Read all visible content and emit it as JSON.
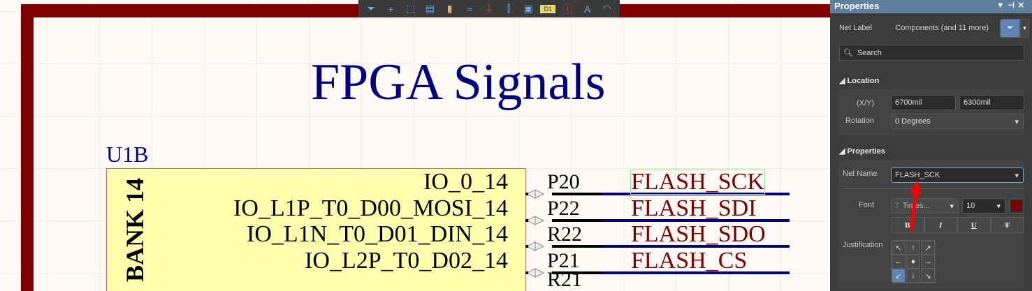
{
  "toolbar": {
    "tools": [
      {
        "name": "filter-icon",
        "glyph": "⏷"
      },
      {
        "name": "crosshair-icon",
        "glyph": "+"
      },
      {
        "name": "select-rect-icon",
        "glyph": "⬚"
      },
      {
        "name": "align-icon",
        "glyph": "▤"
      },
      {
        "name": "component-icon",
        "glyph": "▮"
      },
      {
        "name": "bus-icon",
        "glyph": "≈"
      },
      {
        "name": "ground-icon",
        "glyph": "⏚"
      },
      {
        "name": "port-icon",
        "glyph": "⫿"
      },
      {
        "name": "sheet-symbol-icon",
        "glyph": "▣"
      },
      {
        "name": "designator-icon",
        "glyph": "D1"
      },
      {
        "name": "parameter-icon",
        "glyph": "ⓘ"
      },
      {
        "name": "text-icon",
        "glyph": "A"
      },
      {
        "name": "arc-icon",
        "glyph": "◠"
      }
    ]
  },
  "schematic": {
    "title": "FPGA Signals",
    "designator": "U1B",
    "bank": "BANK 14",
    "pins": [
      {
        "name": "IO_0_14",
        "number": "P20",
        "net": "FLASH_SCK"
      },
      {
        "name": "IO_L1P_T0_D00_MOSI_14",
        "number": "P22",
        "net": "FLASH_SDI"
      },
      {
        "name": "IO_L1N_T0_D01_DIN_14",
        "number": "R22",
        "net": "FLASH_SDO"
      },
      {
        "name": "IO_L2P_T0_D02_14",
        "number": "P21",
        "net": "FLASH_CS"
      }
    ],
    "partial_pin_number": "R21",
    "colors": {
      "border": "#800000",
      "title": "#000080",
      "net": "#800000",
      "wire": "#000080",
      "body": "#ffffad"
    }
  },
  "panel": {
    "title": "Properties",
    "object_type": "Net Label",
    "filter_text": "Components (and 11 more)",
    "search_placeholder": "Search",
    "location": {
      "header": "Location",
      "xy_label": "(X/Y)",
      "x": "6700mil",
      "y": "6300mil",
      "rotation_label": "Rotation",
      "rotation": "0 Degrees"
    },
    "properties": {
      "header": "Properties",
      "net_name_label": "Net Name",
      "net_name": "FLASH_SCK",
      "font_label": "Font",
      "font": "Times...",
      "font_size": "10",
      "font_color": "#800000",
      "styles": [
        "B",
        "I",
        "U",
        "T"
      ],
      "justification_label": "Justification",
      "justification": [
        "↖",
        "↑",
        "↗",
        "←",
        "●",
        "→",
        "↙",
        "↓",
        "↘"
      ],
      "justification_selected": "↙"
    }
  }
}
